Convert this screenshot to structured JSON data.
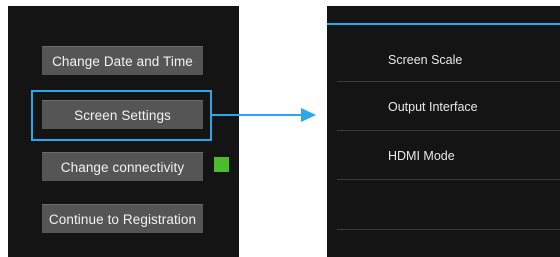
{
  "left_menu": {
    "buttons": [
      {
        "label": "Change Date and Time"
      },
      {
        "label": "Screen Settings"
      },
      {
        "label": "Change connectivity"
      },
      {
        "label": "Continue to Registration"
      }
    ],
    "connectivity_status_color": "#4cbb2c"
  },
  "right_menu": {
    "items": [
      {
        "label": "Screen Scale"
      },
      {
        "label": "Output Interface"
      },
      {
        "label": "HDMI Mode"
      }
    ]
  },
  "colors": {
    "accent": "#2aa7e8",
    "panel_bg": "#141414",
    "button_bg": "#555555"
  }
}
